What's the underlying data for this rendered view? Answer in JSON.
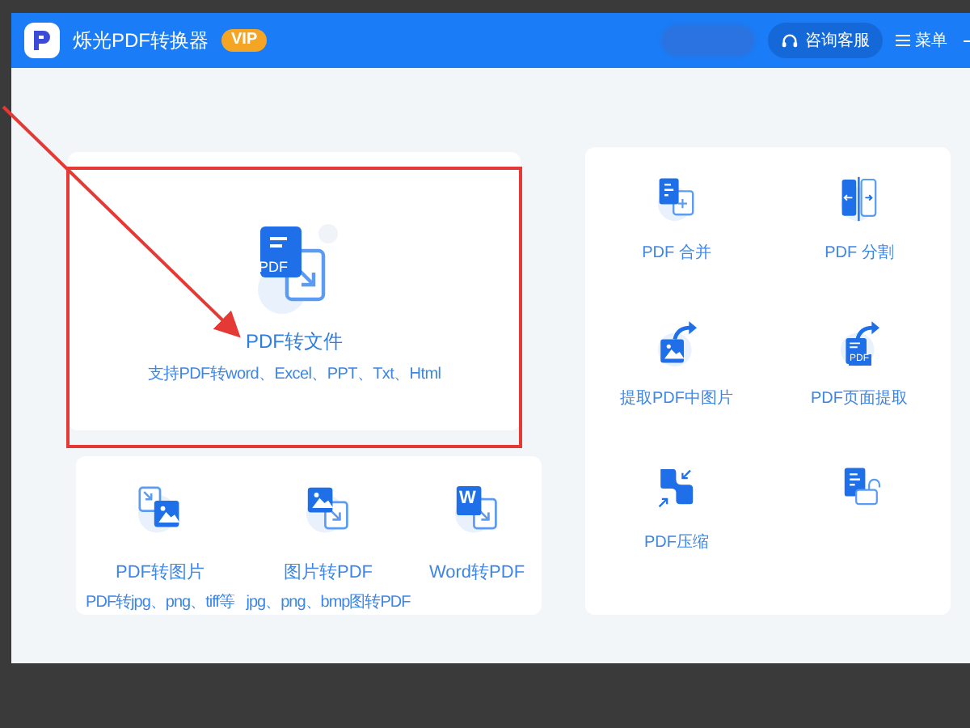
{
  "window": {
    "app_title": "烁光PDF转换器",
    "badge": "VIP"
  },
  "title_bar": {
    "support_button": "咨询客服",
    "menu_button": "菜单"
  },
  "main_tool": {
    "label": "PDF转文件",
    "icon_text": "PDF",
    "description": "支持PDF转word、Excel、PPT、Txt、Html"
  },
  "convert_tools": [
    {
      "label": "PDF转图片",
      "description": "PDF转jpg、png、tiff等"
    },
    {
      "label": "图片转PDF",
      "description": "jpg、png、bmp图转PDF"
    },
    {
      "label": "Word转PDF",
      "icon_text": "W"
    }
  ],
  "pdf_tools": [
    {
      "kind": "labeled",
      "label": "PDF 合并"
    },
    {
      "kind": "labeled",
      "label": "PDF 分割"
    },
    {
      "kind": "labeled",
      "label": "提取PDF中图片"
    },
    {
      "kind": "labeled",
      "label": "PDF页面提取"
    },
    {
      "kind": "labeled",
      "label": "PDF压缩"
    },
    {
      "kind": "icon_only"
    }
  ],
  "page_extract_icon_text": "PDF"
}
